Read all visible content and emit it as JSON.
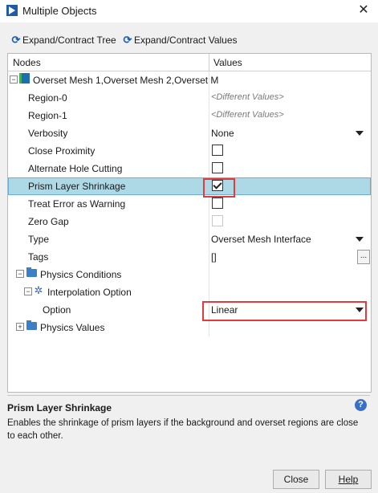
{
  "window": {
    "title": "Multiple Objects",
    "close_glyph": "✕"
  },
  "toolbar": {
    "expand_tree_label": "Expand/Contract Tree",
    "expand_values_label": "Expand/Contract Values"
  },
  "table": {
    "header_nodes": "Nodes",
    "header_values": "Values",
    "root_label": "Overset Mesh 1,Overset Mesh 2,Overset M",
    "rows": [
      {
        "label": "Region-0",
        "value": "<Different Values>"
      },
      {
        "label": "Region-1",
        "value": "<Different Values>"
      },
      {
        "label": "Verbosity",
        "value": "None"
      },
      {
        "label": "Close Proximity",
        "checked": false
      },
      {
        "label": "Alternate Hole Cutting",
        "checked": false
      },
      {
        "label": "Prism Layer Shrinkage",
        "checked": true
      },
      {
        "label": "Treat Error as Warning",
        "checked": false
      },
      {
        "label": "Zero Gap",
        "checked": false
      },
      {
        "label": "Type",
        "value": "Overset Mesh Interface"
      },
      {
        "label": "Tags",
        "value": "[]",
        "button": "..."
      },
      {
        "label": "Physics Conditions"
      },
      {
        "label": "Interpolation Option"
      },
      {
        "label": "Option",
        "value": "Linear"
      },
      {
        "label": "Physics Values"
      }
    ]
  },
  "description": {
    "title": "Prism Layer Shrinkage",
    "text": "Enables the shrinkage of prism layers if the background and overset regions are close to each other."
  },
  "buttons": {
    "close": "Close",
    "help": "Help"
  },
  "colors": {
    "selection": "#add8e6",
    "highlight_box": "#e23b3b",
    "folder": "#3c7fc7"
  },
  "icons": [
    "app-logo-icon",
    "refresh-icon",
    "folder-icon",
    "mesh-icon",
    "interpolation-icon",
    "help-icon"
  ]
}
